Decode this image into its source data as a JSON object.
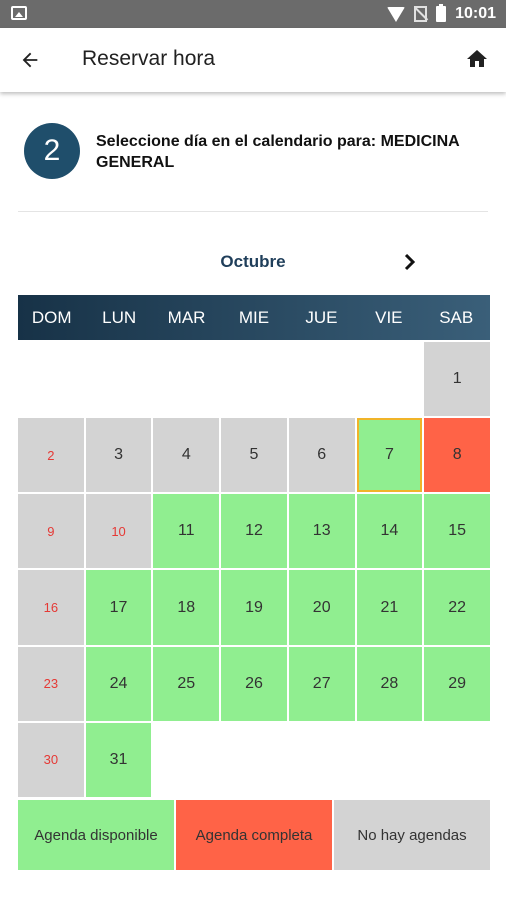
{
  "status_bar": {
    "time": "10:01",
    "icons": [
      "gallery-icon",
      "wifi-icon",
      "no-sim-icon",
      "battery-icon"
    ]
  },
  "app_bar": {
    "title": "Reservar hora",
    "back_icon": "arrow-left-icon",
    "home_icon": "home-icon"
  },
  "step": {
    "number": "2",
    "text": "Seleccione día en el calendario para: MEDICINA GENERAL"
  },
  "calendar": {
    "month": "Octubre",
    "next_icon": "chevron-right-icon",
    "weekdays": [
      "DOM",
      "LUN",
      "MAR",
      "MIE",
      "JUE",
      "VIE",
      "SAB"
    ],
    "weeks": [
      [
        null,
        null,
        null,
        null,
        null,
        null,
        {
          "day": "1",
          "status": "none"
        }
      ],
      [
        {
          "day": "2",
          "status": "none"
        },
        {
          "day": "3",
          "status": "none"
        },
        {
          "day": "4",
          "status": "none"
        },
        {
          "day": "5",
          "status": "none"
        },
        {
          "day": "6",
          "status": "none"
        },
        {
          "day": "7",
          "status": "available",
          "today": true
        },
        {
          "day": "8",
          "status": "full"
        }
      ],
      [
        {
          "day": "9",
          "status": "none"
        },
        {
          "day": "10",
          "status": "none",
          "red": true
        },
        {
          "day": "11",
          "status": "available"
        },
        {
          "day": "12",
          "status": "available"
        },
        {
          "day": "13",
          "status": "available"
        },
        {
          "day": "14",
          "status": "available"
        },
        {
          "day": "15",
          "status": "available"
        }
      ],
      [
        {
          "day": "16",
          "status": "none"
        },
        {
          "day": "17",
          "status": "available"
        },
        {
          "day": "18",
          "status": "available"
        },
        {
          "day": "19",
          "status": "available"
        },
        {
          "day": "20",
          "status": "available"
        },
        {
          "day": "21",
          "status": "available"
        },
        {
          "day": "22",
          "status": "available"
        }
      ],
      [
        {
          "day": "23",
          "status": "none"
        },
        {
          "day": "24",
          "status": "available"
        },
        {
          "day": "25",
          "status": "available"
        },
        {
          "day": "26",
          "status": "available"
        },
        {
          "day": "27",
          "status": "available"
        },
        {
          "day": "28",
          "status": "available"
        },
        {
          "day": "29",
          "status": "available"
        }
      ],
      [
        {
          "day": "30",
          "status": "none"
        },
        {
          "day": "31",
          "status": "available"
        },
        null,
        null,
        null,
        null,
        null
      ]
    ]
  },
  "legend": {
    "available": "Agenda disponible",
    "full": "Agenda completa",
    "none": "No hay agendas"
  },
  "colors": {
    "available": "#90ee90",
    "full": "#ff6347",
    "none": "#d3d3d3",
    "header": "#173247",
    "accent": "#1f4e6b"
  }
}
